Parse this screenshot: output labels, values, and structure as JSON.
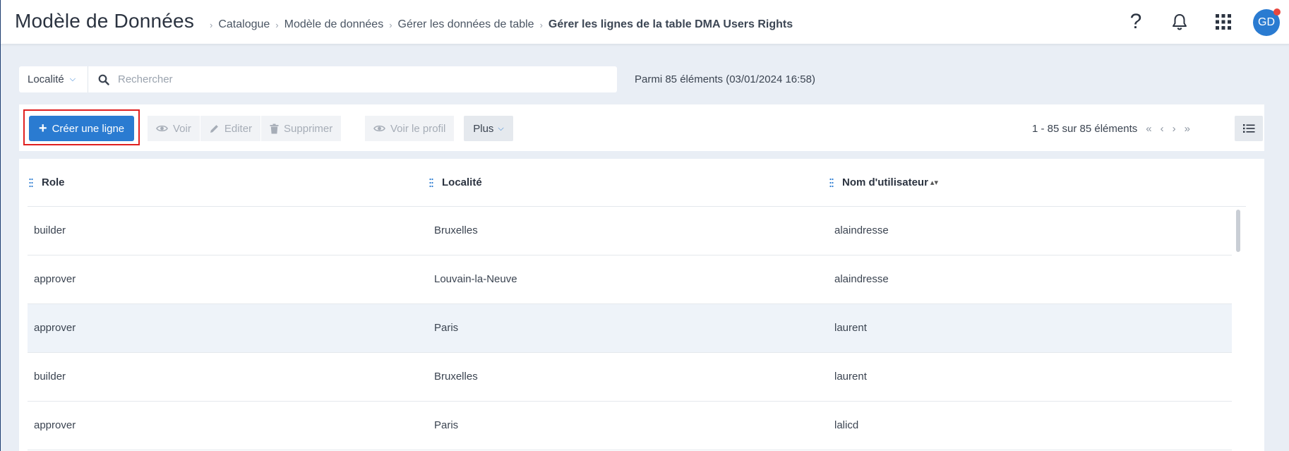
{
  "header": {
    "app_title": "Modèle de Données",
    "breadcrumb": [
      "Catalogue",
      "Modèle de données",
      "Gérer les données de table"
    ],
    "breadcrumb_current": "Gérer les lignes de la table DMA Users Rights",
    "avatar_initials": "GD"
  },
  "search": {
    "locality_label": "Localité",
    "placeholder": "Rechercher",
    "count_text": "Parmi 85 éléments (03/01/2024 16:58)"
  },
  "toolbar": {
    "create_label": "Créer une ligne",
    "view_label": "Voir",
    "edit_label": "Editer",
    "delete_label": "Supprimer",
    "profile_label": "Voir le profil",
    "more_label": "Plus",
    "pagination": "1 - 85 sur 85 éléments"
  },
  "table": {
    "columns": [
      "Role",
      "Localité",
      "Nom d'utilisateur"
    ],
    "rows": [
      [
        "builder",
        "Bruxelles",
        "alaindresse"
      ],
      [
        "approver",
        "Louvain-la-Neuve",
        "alaindresse"
      ],
      [
        "approver",
        "Paris",
        "laurent"
      ],
      [
        "builder",
        "Bruxelles",
        "laurent"
      ],
      [
        "approver",
        "Paris",
        "lalicd"
      ]
    ],
    "selected_row": 2
  },
  "colors": {
    "primary": "#2a7bd1",
    "highlight_border": "#e02020",
    "notification_dot": "#e8473f"
  }
}
